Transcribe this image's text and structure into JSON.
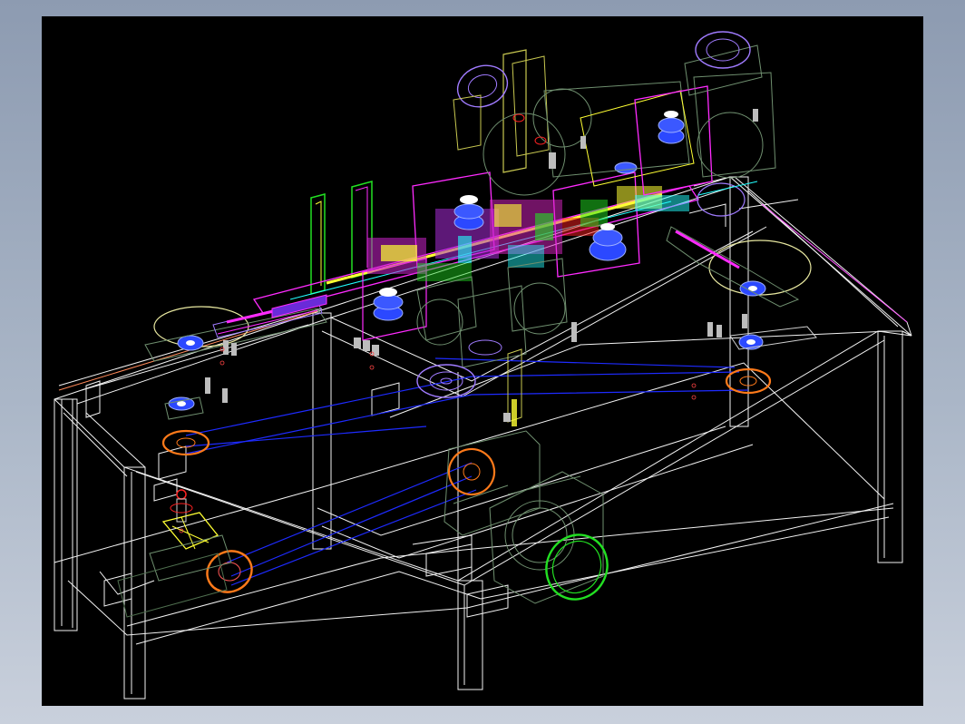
{
  "view": {
    "background_color": "#000000",
    "frame_color": "#9aa7ba",
    "render_style": "wireframe"
  },
  "palette": {
    "frame": "#ffffff",
    "belt": "#1e2bff",
    "pulley": "#ff7a1a",
    "motor": "#22e022",
    "roller": "#4a6bff",
    "magenta": "#ff2bff",
    "yellow": "#ffff33",
    "cyan": "#22ffff",
    "violet": "#a07bff",
    "olive": "#c8c850",
    "gray_green": "#6f8f6f",
    "red": "#ff2222"
  }
}
